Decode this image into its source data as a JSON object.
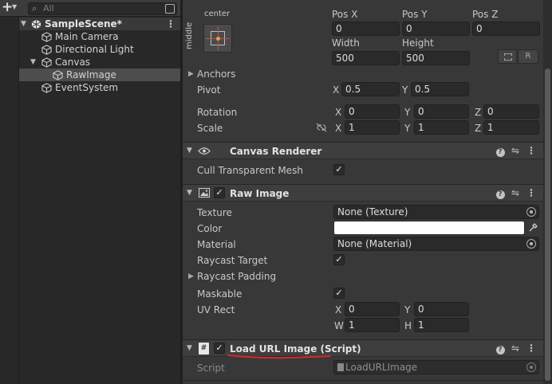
{
  "hierarchy": {
    "add_icon": "+",
    "search_placeholder": "All",
    "items": [
      {
        "label": "SampleScene*"
      },
      {
        "label": "Main Camera"
      },
      {
        "label": "Directional Light"
      },
      {
        "label": "Canvas"
      },
      {
        "label": "RawImage"
      },
      {
        "label": "EventSystem"
      }
    ]
  },
  "rect_transform": {
    "anchor_preset_top": "center",
    "anchor_preset_side": "middle",
    "pos_x_label": "Pos X",
    "pos_x": "0",
    "pos_y_label": "Pos Y",
    "pos_y": "0",
    "pos_z_label": "Pos Z",
    "pos_z": "0",
    "width_label": "Width",
    "width": "500",
    "height_label": "Height",
    "height": "500",
    "r_button": "R",
    "anchors_label": "Anchors",
    "pivot_label": "Pivot",
    "pivot_x_label": "X",
    "pivot_x": "0.5",
    "pivot_y_label": "Y",
    "pivot_y": "0.5",
    "rotation_label": "Rotation",
    "rot_x_label": "X",
    "rot_x": "0",
    "rot_y_label": "Y",
    "rot_y": "0",
    "rot_z_label": "Z",
    "rot_z": "0",
    "scale_label": "Scale",
    "scale_x_label": "X",
    "scale_x": "1",
    "scale_y_label": "Y",
    "scale_y": "1",
    "scale_z_label": "Z",
    "scale_z": "1"
  },
  "canvas_renderer": {
    "title": "Canvas Renderer",
    "cull_label": "Cull Transparent Mesh",
    "cull_checked": "✓"
  },
  "raw_image": {
    "title": "Raw Image",
    "enabled": "✓",
    "texture_label": "Texture",
    "texture_value": "None (Texture)",
    "color_label": "Color",
    "color_value": "#ffffff",
    "material_label": "Material",
    "material_value": "None (Material)",
    "raycast_target_label": "Raycast Target",
    "raycast_target_checked": "✓",
    "raycast_padding_label": "Raycast Padding",
    "maskable_label": "Maskable",
    "maskable_checked": "✓",
    "uv_rect_label": "UV Rect",
    "uv_x_label": "X",
    "uv_x": "0",
    "uv_y_label": "Y",
    "uv_y": "0",
    "uv_w_label": "W",
    "uv_w": "1",
    "uv_h_label": "H",
    "uv_h": "1"
  },
  "load_url_image": {
    "title": "Load URL Image (Script)",
    "enabled": "✓",
    "script_label": "Script",
    "script_value": "LoadURLImage"
  },
  "colors": {
    "annotation_underline": "#d42a2a",
    "anchor_marker": "#e8a040"
  }
}
